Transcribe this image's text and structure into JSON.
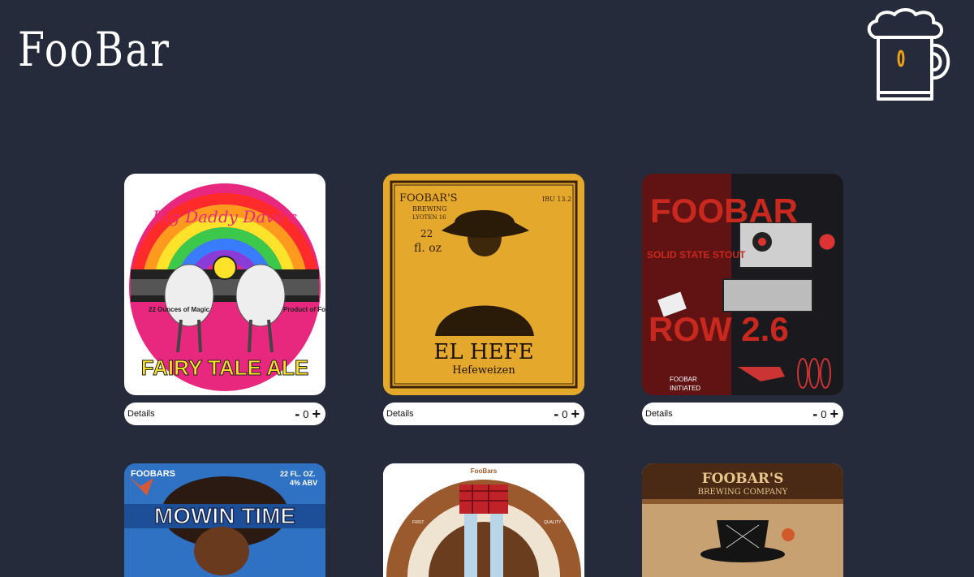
{
  "header": {
    "brand": "FooBar",
    "cart_icon": "beer-mug-icon"
  },
  "products": [
    {
      "id": "fairy-tale-ale",
      "label_texts": [
        "Big Daddy Dave's",
        "22 Ounces of Magic",
        "Product of FooBar",
        "FAIRY TALE ALE"
      ],
      "details_label": "Details",
      "quantity": "0",
      "minus": "-",
      "plus": "+"
    },
    {
      "id": "el-hefe",
      "label_texts": [
        "FOOBAR'S",
        "BREWING",
        "LYOTEN 16",
        "IBU 13.2",
        "22",
        "fl. oz",
        "EL HEFE",
        "Hefeweizen"
      ],
      "details_label": "Details",
      "quantity": "0",
      "minus": "-",
      "plus": "+"
    },
    {
      "id": "row-26",
      "label_texts": [
        "FOOBAR",
        "SOLID STATE STOUT",
        "ROW 2.6",
        "FOOBAR",
        "INITIATED"
      ],
      "details_label": "Details",
      "quantity": "0",
      "minus": "-",
      "plus": "+"
    },
    {
      "id": "mowintime",
      "label_texts": [
        "FOOBARS",
        "22 FL. OZ.",
        "4% ABV",
        "MOWIN TIME"
      ]
    },
    {
      "id": "hoppily-ever-after",
      "label_texts": [
        "FooBars",
        "FIRST",
        "QUALITY"
      ]
    },
    {
      "id": "steampunk",
      "label_texts": [
        "FOOBAR'S",
        "BREWING COMPANY"
      ]
    }
  ]
}
